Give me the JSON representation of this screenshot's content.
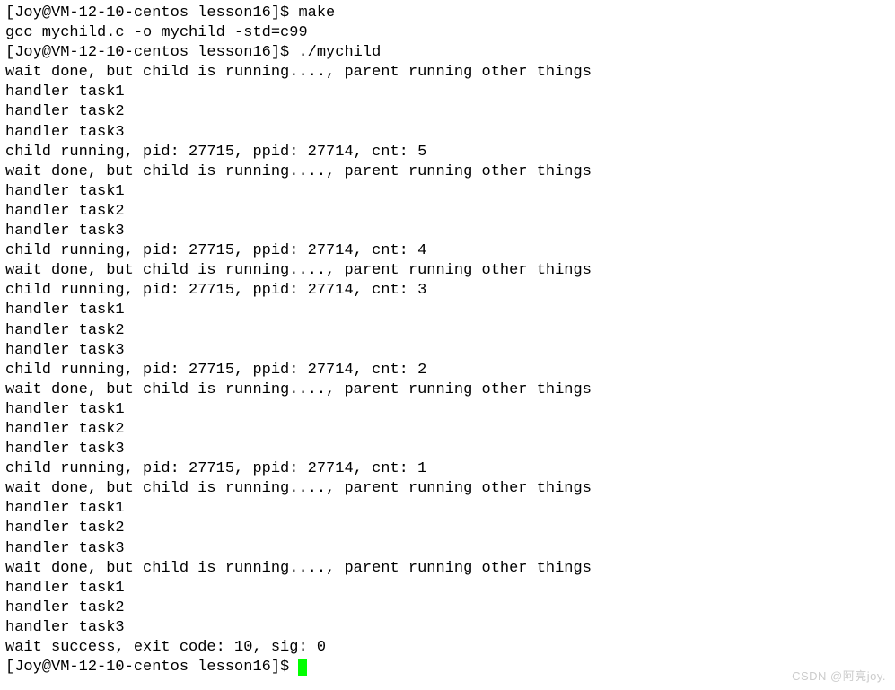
{
  "terminal": {
    "prompt": "[Joy@VM-12-10-centos lesson16]$ ",
    "lines": [
      "[Joy@VM-12-10-centos lesson16]$ make",
      "gcc mychild.c -o mychild -std=c99",
      "[Joy@VM-12-10-centos lesson16]$ ./mychild",
      "wait done, but child is running...., parent running other things",
      "handler task1",
      "handler task2",
      "handler task3",
      "child running, pid: 27715, ppid: 27714, cnt: 5",
      "wait done, but child is running...., parent running other things",
      "handler task1",
      "handler task2",
      "handler task3",
      "child running, pid: 27715, ppid: 27714, cnt: 4",
      "wait done, but child is running...., parent running other things",
      "child running, pid: 27715, ppid: 27714, cnt: 3",
      "handler task1",
      "handler task2",
      "handler task3",
      "child running, pid: 27715, ppid: 27714, cnt: 2",
      "wait done, but child is running...., parent running other things",
      "handler task1",
      "handler task2",
      "handler task3",
      "child running, pid: 27715, ppid: 27714, cnt: 1",
      "wait done, but child is running...., parent running other things",
      "handler task1",
      "handler task2",
      "handler task3",
      "wait done, but child is running...., parent running other things",
      "handler task1",
      "handler task2",
      "handler task3",
      "wait success, exit code: 10, sig: 0"
    ]
  },
  "watermark": "CSDN @阿亮joy."
}
